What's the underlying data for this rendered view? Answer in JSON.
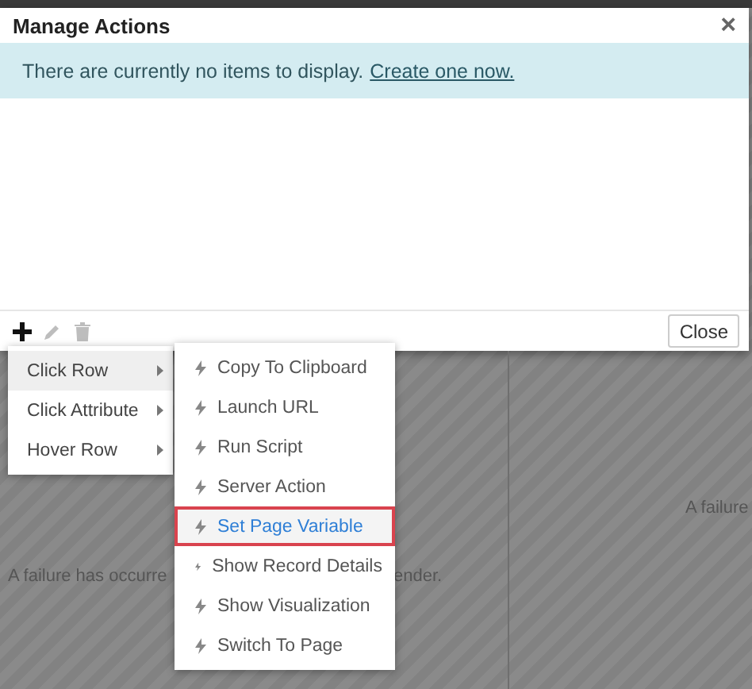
{
  "dialog": {
    "title": "Manage Actions",
    "close_icon": "×",
    "alert": {
      "text": "There are currently no items to display.",
      "link": "Create one now."
    },
    "toolbar": [
      {
        "kind": "add",
        "disabled": false
      },
      {
        "kind": "edit",
        "disabled": true
      },
      {
        "kind": "delete",
        "disabled": true
      }
    ],
    "close_button": "Close"
  },
  "background": {
    "left_text": "A failure has occurre",
    "left_text_end": "ender.",
    "right_text": "A failure"
  },
  "menu": {
    "items": [
      {
        "label": "Click Row",
        "selected": true
      },
      {
        "label": "Click Attribute",
        "selected": false
      },
      {
        "label": "Hover Row",
        "selected": false
      }
    ]
  },
  "submenu": {
    "items": [
      {
        "label": "Copy To Clipboard",
        "selected": false
      },
      {
        "label": "Launch URL",
        "selected": false
      },
      {
        "label": "Run Script",
        "selected": false
      },
      {
        "label": "Server Action",
        "selected": false
      },
      {
        "label": "Set Page Variable",
        "selected": true
      },
      {
        "label": "Show Record Details",
        "selected": false
      },
      {
        "label": "Show Visualization",
        "selected": false
      },
      {
        "label": "Switch To Page",
        "selected": false
      }
    ]
  }
}
